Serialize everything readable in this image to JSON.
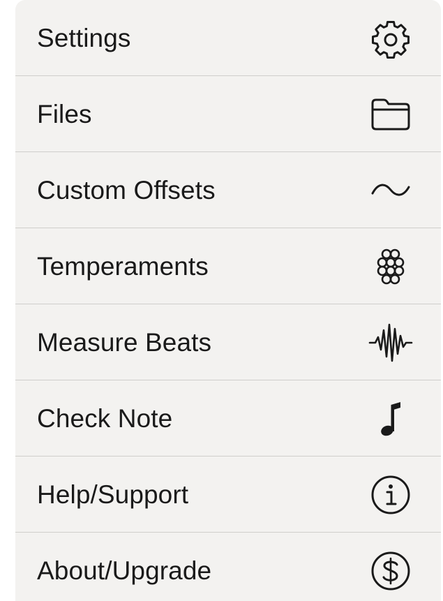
{
  "menu": {
    "items": [
      {
        "label": "Settings",
        "icon": "gear-icon"
      },
      {
        "label": "Files",
        "icon": "folder-icon"
      },
      {
        "label": "Custom Offsets",
        "icon": "tilde-wave-icon"
      },
      {
        "label": "Temperaments",
        "icon": "circle-cluster-icon"
      },
      {
        "label": "Measure Beats",
        "icon": "waveform-icon"
      },
      {
        "label": "Check Note",
        "icon": "music-note-icon"
      },
      {
        "label": "Help/Support",
        "icon": "info-circle-icon"
      },
      {
        "label": "About/Upgrade",
        "icon": "dollar-circle-icon"
      }
    ]
  },
  "colors": {
    "menu_background": "#f3f2f0",
    "separator": "#cfcecb",
    "text": "#1a1a1a"
  }
}
